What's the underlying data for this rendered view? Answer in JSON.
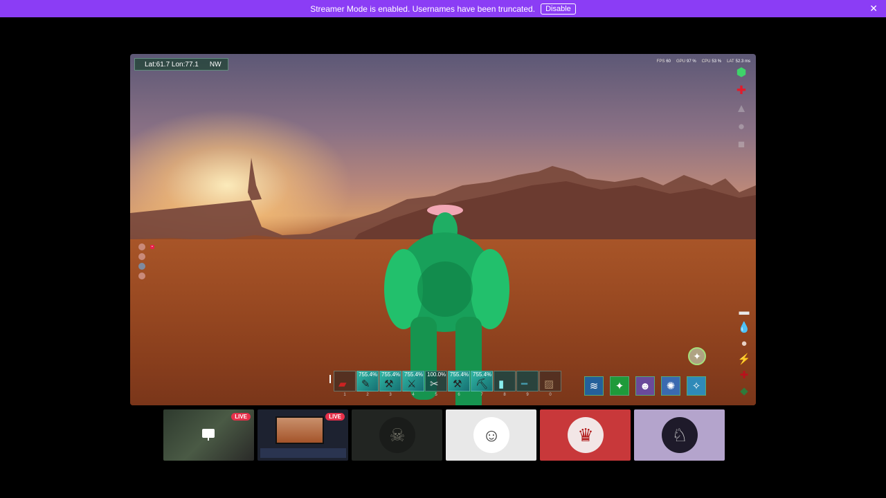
{
  "banner": {
    "text": "Streamer Mode is enabled. Usernames have been truncated.",
    "button": "Disable",
    "close": "✕"
  },
  "hud": {
    "coords": "Lat:61.7 Lon:77.1",
    "direction": "NW",
    "stats": [
      {
        "label": "FPS",
        "value": "60"
      },
      {
        "label": "GPU",
        "value": "97 %"
      },
      {
        "label": "CPU",
        "value": "53 %"
      },
      {
        "label": "LAT",
        "value": "52.3 ms"
      }
    ]
  },
  "hotbar": {
    "slots": [
      {
        "pct": "",
        "num": "1"
      },
      {
        "pct": "755.4%",
        "num": "2"
      },
      {
        "pct": "755.4%",
        "num": "3"
      },
      {
        "pct": "755.4%",
        "num": "4"
      },
      {
        "pct": "100.0%",
        "num": "5"
      },
      {
        "pct": "755.4%",
        "num": "6"
      },
      {
        "pct": "755.4%",
        "num": "7"
      },
      {
        "pct": "",
        "num": "8"
      },
      {
        "pct": "",
        "num": "9"
      },
      {
        "pct": "",
        "num": "0"
      }
    ]
  },
  "tiles": {
    "live1": "LIVE",
    "live2": "LIVE"
  },
  "colors": {
    "banner": "#8b3df5",
    "live": "#e6304a",
    "accent_green": "#2fb7a4"
  }
}
